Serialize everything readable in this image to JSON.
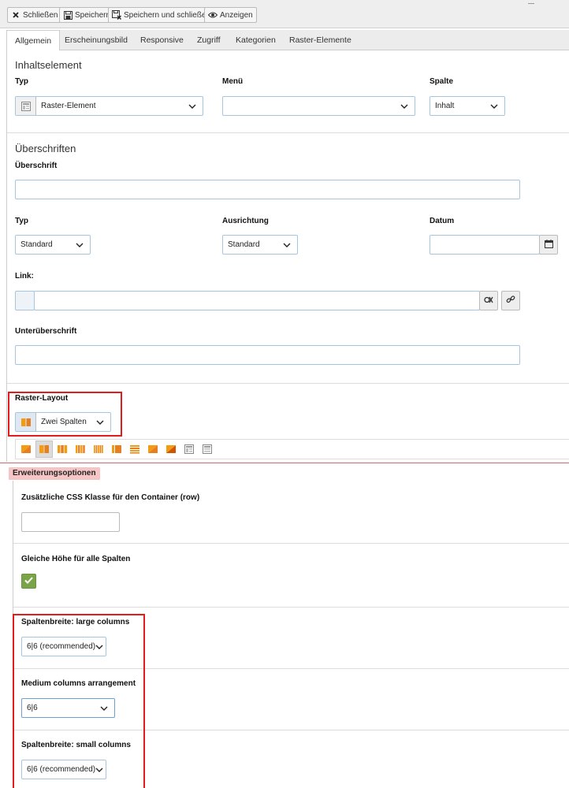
{
  "toolbar": {
    "buttons": [
      {
        "label": "Schließen",
        "icon": "close-icon"
      },
      {
        "label": "Speichern",
        "icon": "save-icon"
      },
      {
        "label": "Speichern und schließen",
        "icon": "save-close-icon"
      },
      {
        "label": "Anzeigen",
        "icon": "eye-icon"
      }
    ]
  },
  "tabs": [
    "Allgemein",
    "Erscheinungsbild",
    "Responsive",
    "Zugriff",
    "Kategorien",
    "Raster-Elemente"
  ],
  "active_tab": "Allgemein",
  "inhaltselement": {
    "title": "Inhaltselement",
    "typ_label": "Typ",
    "typ_value": "Raster-Element",
    "menu_label": "Menü",
    "menu_value": "",
    "spalte_label": "Spalte",
    "spalte_value": "Inhalt"
  },
  "ueberschriften": {
    "title": "Überschriften",
    "ueberschrift_label": "Überschrift",
    "ueberschrift_value": "",
    "typ_label": "Typ",
    "typ_value": "Standard",
    "ausrichtung_label": "Ausrichtung",
    "ausrichtung_value": "Standard",
    "datum_label": "Datum",
    "datum_value": "",
    "link_label": "Link:",
    "link_value": "",
    "unterueberschrift_label": "Unterüberschrift",
    "unterueberschrift_value": ""
  },
  "raster": {
    "label": "Raster-Layout",
    "value": "Zwei Spalten",
    "layout_icons": [
      "one-column",
      "two-columns",
      "three-columns",
      "four-columns",
      "five-columns",
      "three-columns-wide",
      "stacked-rows",
      "single-block",
      "two-blocks",
      "table-grid",
      "table-grid-alt"
    ]
  },
  "erweiterung": {
    "badge": "Erweiterungsoptionen",
    "css_label": "Zusätzliche CSS Klasse für den Container (row)",
    "css_value": "",
    "gleiche_label": "Gleiche Höhe für alle Spalten",
    "gleiche_checked": true,
    "large_label": "Spaltenbreite: large columns",
    "large_value": "6|6 (recommended)",
    "medium_label": "Medium columns arrangement",
    "medium_value": "6|6",
    "small_label": "Spaltenbreite: small columns",
    "small_value": "6|6 (recommended)"
  },
  "colors": {
    "highlight": "#e21b1b",
    "checkbox": "#79a548",
    "badge_bg": "#f6c6c6",
    "input_border": "#a6c5e3"
  }
}
